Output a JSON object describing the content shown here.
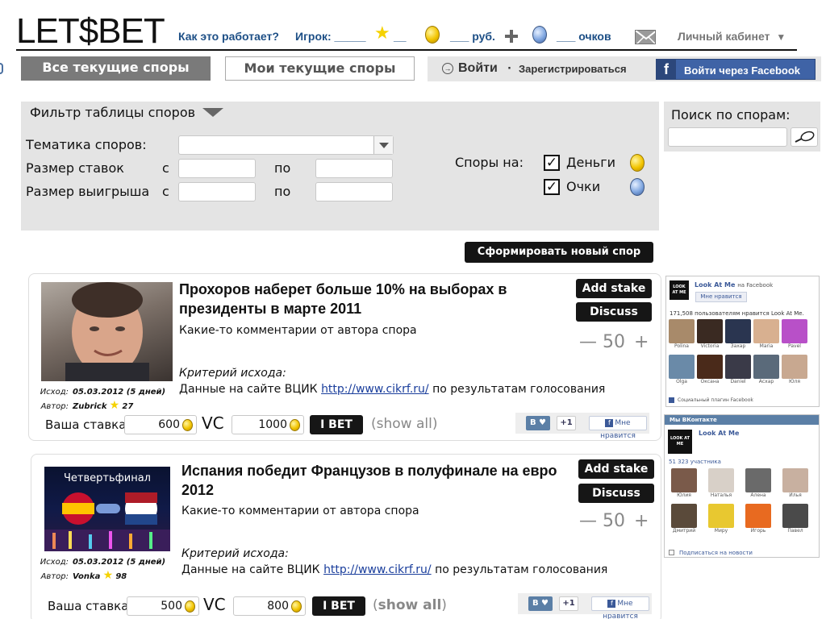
{
  "header": {
    "logo": "LET$BET",
    "how_it_works": "Как это работает?",
    "player_label": "Игрок: _____",
    "player_suffix": "__",
    "rub_label": "___ руб.",
    "points_label": "___ очков",
    "cabinet": "Личный кабинет"
  },
  "tabs": {
    "all": "Все текущие споры",
    "mine": "Мои текущие споры"
  },
  "auth": {
    "login": "Войти",
    "separator": "·",
    "register": "Зарегистрироваться",
    "facebook": "Войти через Facebook"
  },
  "filter": {
    "title": "Фильтр таблицы споров",
    "topic_label": "Тематика споров:",
    "stake_label": "Размер ставок",
    "win_label": "Размер выигрыша",
    "from": "с",
    "to": "по",
    "bets_on_label": "Споры на:",
    "money_label": "Деньги",
    "points_label": "Очки",
    "money_checked": true,
    "points_checked": true
  },
  "search": {
    "title": "Поиск по спорам:",
    "value": ""
  },
  "new_bet_button": "Сформировать новый спор",
  "bets": [
    {
      "title": "Прохоров наберет больше 10% на выборах в президенты в марте 2011",
      "comment": "Какие-то комментарии от автора спора",
      "criteria_label": "Критерий исхода:",
      "criteria_prefix": "Данные на сайте ВЦИК",
      "criteria_link": "http://www.cikrf.ru/",
      "criteria_suffix": "по результатам голосования",
      "outcome_label": "Исход:",
      "outcome_value": "05.03.2012 (5 дней)",
      "author_label": "Автор:",
      "author_name": "Zubrick",
      "author_rating": "27",
      "add_stake": "Add stake",
      "discuss": "Discuss",
      "minus": "—",
      "step_value": "50",
      "plus": "+",
      "stake_label": "Ваша ставка:",
      "stake_money": "600",
      "vc": "VC",
      "stake_points": "1000",
      "ibet": "I BET",
      "show_all": "(show all)",
      "image_text": ""
    },
    {
      "title": "Испания победит Французов в полуфинале на евро 2012",
      "comment": "Какие-то комментарии от автора спора",
      "criteria_label": "Критерий исхода:",
      "criteria_prefix": "Данные на сайте ВЦИК",
      "criteria_link": "http://www.cikrf.ru/",
      "criteria_suffix": "по результатам голосования",
      "outcome_label": "Исход:",
      "outcome_value": "05.03.2012 (5 дней)",
      "author_label": "Автор:",
      "author_name": "Vonka",
      "author_rating": "98",
      "add_stake": "Add stake",
      "discuss": "Discuss",
      "minus": "—",
      "step_value": "50",
      "plus": "+",
      "stake_label": "Ваша ставка:",
      "stake_money": "500",
      "vc": "VC",
      "stake_points": "800",
      "ibet": "I BET",
      "show_all_open": "(",
      "show_all_word": "show all",
      "show_all_close": ")",
      "image_text": "Четвертьфинал"
    }
  ],
  "social": {
    "vk_like": "В ♥",
    "plus_one": "+1",
    "fb_like": "Мне нравится"
  },
  "fb_widget": {
    "brand": "LOOK AT ME",
    "page_name": "Look At Me",
    "on": "на Facebook",
    "like_btn": "Мне нравится",
    "count_text": "171,508 пользователям нравится Look At Me.",
    "people": [
      "Polina",
      "Victoria",
      "Захар",
      "Maria",
      "Pavel",
      "Olga",
      "Оксана",
      "Daniel",
      "Асхар",
      "Юля"
    ],
    "plugin": "Социальный плагин Facebook"
  },
  "vk_widget": {
    "header": "Мы ВКонтакте",
    "brand": "LOOK AT ME",
    "page_name": "Look At Me",
    "members": "51 323 участника",
    "people": [
      "Юлия",
      "Наталья",
      "Алена",
      "Илья",
      "Дмитрий",
      "Миру",
      "Игорь",
      "Павел"
    ],
    "subscribe": "Подписаться на новости"
  },
  "colors": {
    "tab_active_bg": "#7a7a7a",
    "panel_bg": "#e4e4e4",
    "link_blue": "#1d4f86",
    "facebook_blue": "#3f63a6",
    "button_dark": "#161616"
  },
  "icons": [
    "star-icon",
    "gold-coin-icon",
    "plus-icon",
    "blue-coin-icon",
    "envelope-icon",
    "dropdown-triangle-icon",
    "login-arrow-icon",
    "facebook-icon",
    "checkbox-icon",
    "magnifier-icon"
  ]
}
